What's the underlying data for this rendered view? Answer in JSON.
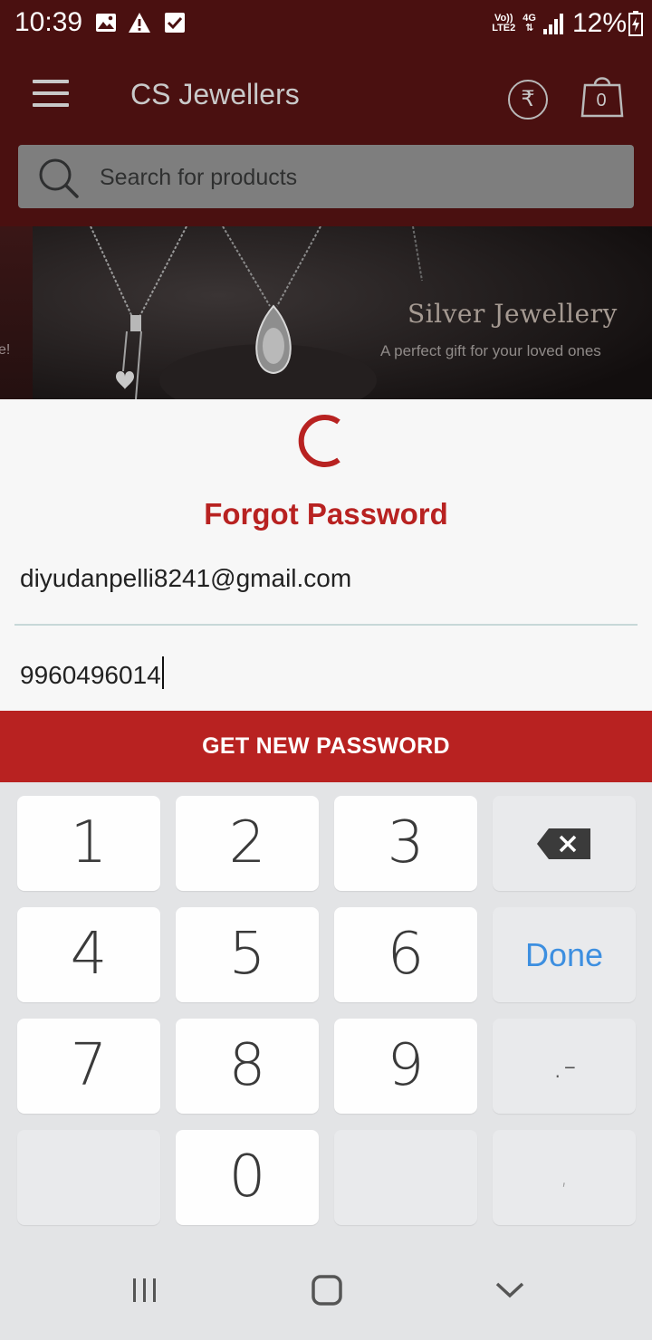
{
  "status_bar": {
    "time": "10:39",
    "left_icons": [
      "image-icon",
      "warning-icon",
      "check-box-icon"
    ],
    "volte": "Vo))",
    "lte": "LTE2",
    "network": "4G",
    "battery": "12%"
  },
  "header": {
    "title": "CS Jewellers",
    "cart_count": "0",
    "search_placeholder": "Search for products"
  },
  "banner": {
    "left_fragment": "e!",
    "title": "Silver Jewellery",
    "subtitle": "A perfect gift for your loved ones"
  },
  "dialog": {
    "title": "Forgot Password",
    "email_value": "diyudanpelli8241@gmail.com",
    "phone_value": "9960496014",
    "submit_label": "GET NEW PASSWORD"
  },
  "keyboard": {
    "row1": [
      "1",
      "2",
      "3"
    ],
    "row2": [
      "4",
      "5",
      "6"
    ],
    "row3": [
      "7",
      "8",
      "9"
    ],
    "zero": "0",
    "done_label": "Done",
    "symbol_key": ".-",
    "comma_key": ","
  },
  "colors": {
    "accent": "#b82221",
    "app_bar": "#4a1010",
    "done": "#3d8fe0"
  }
}
